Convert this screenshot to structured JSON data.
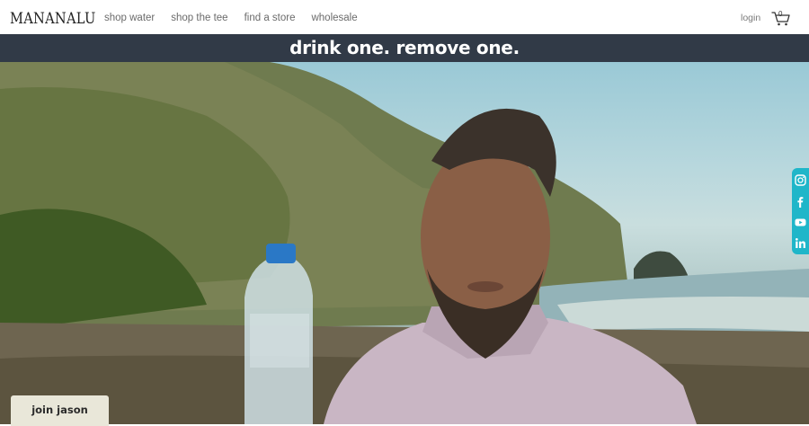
{
  "brand": {
    "logo": "MANANALU"
  },
  "nav": {
    "items": [
      {
        "label": "shop water"
      },
      {
        "label": "shop the tee"
      },
      {
        "label": "find a store"
      },
      {
        "label": "wholesale"
      }
    ]
  },
  "account": {
    "login_label": "login"
  },
  "cart": {
    "count": "0",
    "icon": "shopping-cart-icon"
  },
  "banner": {
    "text": "drink one. remove one."
  },
  "social": {
    "items": [
      {
        "icon": "instagram-icon"
      },
      {
        "icon": "facebook-icon"
      },
      {
        "icon": "youtube-icon"
      },
      {
        "icon": "linkedin-icon"
      }
    ]
  },
  "cta": {
    "label": "join jason"
  },
  "colors": {
    "banner_bg": "#313a47",
    "social_bg": "#1fb6c9",
    "cta_bg": "#e9e7d9"
  }
}
